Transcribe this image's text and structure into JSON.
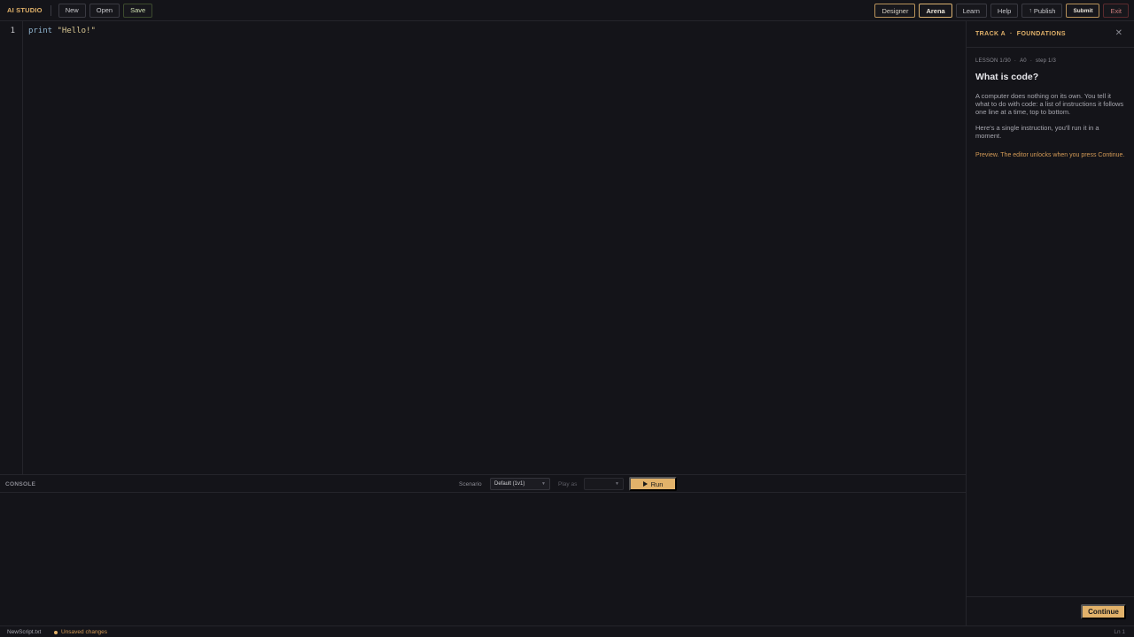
{
  "app": {
    "logo": "AI STUDIO"
  },
  "toolbar": {
    "new_label": "New",
    "open_label": "Open",
    "save_label": "Save",
    "designer_label": "Designer",
    "arena_label": "Arena",
    "learn_label": "Learn",
    "help_label": "Help",
    "publish_label": "Publish",
    "submit_label": "Submit",
    "exit_label": "Exit"
  },
  "editor": {
    "lines": [
      {
        "number": "1",
        "keyword": "print",
        "string": "\"Hello!\""
      }
    ]
  },
  "console": {
    "title": "CONSOLE",
    "scenario_label": "Scenario",
    "scenario_value": "Default (1v1)",
    "play_as_label": "Play as",
    "play_as_value": "",
    "run_label": "Run"
  },
  "lesson": {
    "track": "TRACK A",
    "track_name": "FOUNDATIONS",
    "lesson_num": "LESSON 1/30",
    "level": "A0",
    "step": "step 1/3",
    "title": "What is code?",
    "para1": "A computer does nothing on its own. You tell it what to do with code: a list of instructions it follows one line at a time, top to bottom.",
    "para2": "Here's a single instruction, you'll run it in a moment.",
    "note": "Preview. The editor unlocks when you press Continue.",
    "continue_label": "Continue"
  },
  "status": {
    "filename": "NewScript.txt",
    "unsaved": "Unsaved changes",
    "position": "Ln 1"
  },
  "colors": {
    "accent": "#e2b26a",
    "background": "#141419",
    "exit": "#c97a7a"
  }
}
